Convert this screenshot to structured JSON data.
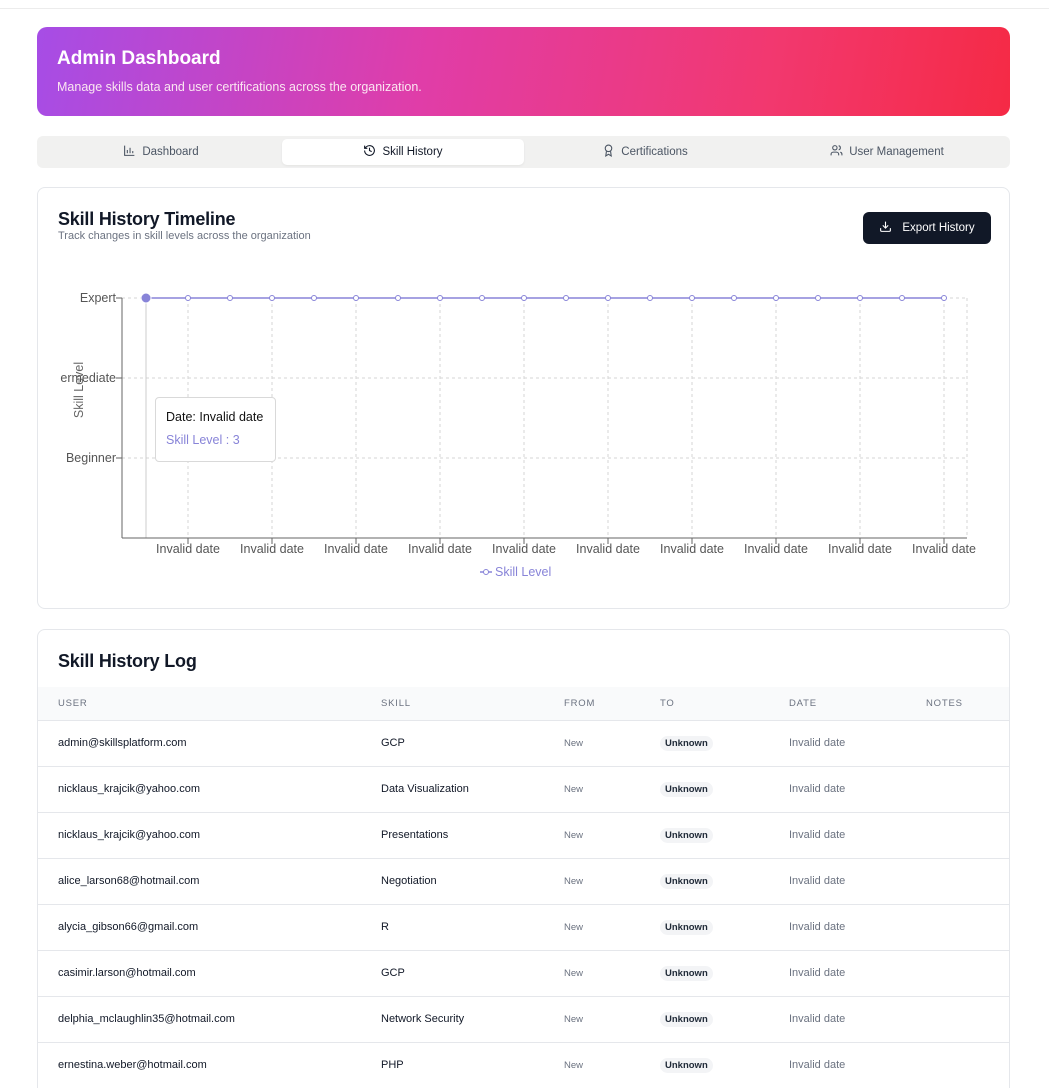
{
  "header": {
    "title": "Admin Dashboard",
    "subtitle": "Manage skills data and user certifications across the organization."
  },
  "tabs": [
    {
      "label": "Dashboard",
      "icon": "bar-chart-icon",
      "active": false
    },
    {
      "label": "Skill History",
      "icon": "history-icon",
      "active": true
    },
    {
      "label": "Certifications",
      "icon": "award-icon",
      "active": false
    },
    {
      "label": "User Management",
      "icon": "users-icon",
      "active": false
    }
  ],
  "timeline": {
    "title": "Skill History Timeline",
    "subtitle": "Track changes in skill levels across the organization",
    "export_label": "Export History",
    "export_icon": "download-icon",
    "tooltip": {
      "date_line": "Date: Invalid date",
      "value_line": "Skill Level : 3"
    }
  },
  "chart_data": {
    "type": "line",
    "ylabel": "Skill Level",
    "y_ticks": [
      {
        "value": 1,
        "label": "Beginner"
      },
      {
        "value": 2,
        "label": "ermediate"
      },
      {
        "value": 3,
        "label": "Expert"
      }
    ],
    "ylim": [
      0,
      3
    ],
    "x_tick_labels": [
      "Invalid date",
      "Invalid date",
      "Invalid date",
      "Invalid date",
      "Invalid date",
      "Invalid date",
      "Invalid date",
      "Invalid date",
      "Invalid date",
      "Invalid date"
    ],
    "series": [
      {
        "name": "Skill Level",
        "color": "#8884d8",
        "values": [
          3,
          3,
          3,
          3,
          3,
          3,
          3,
          3,
          3,
          3,
          3,
          3,
          3,
          3,
          3,
          3,
          3,
          3,
          3,
          3
        ]
      }
    ],
    "active_index": 0,
    "grid": true,
    "legend": "bottom"
  },
  "log": {
    "title": "Skill History Log",
    "columns": [
      "USER",
      "SKILL",
      "FROM",
      "TO",
      "DATE",
      "NOTES"
    ],
    "rows": [
      {
        "user": "admin@skillsplatform.com",
        "skill": "GCP",
        "from": "New",
        "to": "Unknown",
        "date": "Invalid date",
        "notes": ""
      },
      {
        "user": "nicklaus_krajcik@yahoo.com",
        "skill": "Data Visualization",
        "from": "New",
        "to": "Unknown",
        "date": "Invalid date",
        "notes": ""
      },
      {
        "user": "nicklaus_krajcik@yahoo.com",
        "skill": "Presentations",
        "from": "New",
        "to": "Unknown",
        "date": "Invalid date",
        "notes": ""
      },
      {
        "user": "alice_larson68@hotmail.com",
        "skill": "Negotiation",
        "from": "New",
        "to": "Unknown",
        "date": "Invalid date",
        "notes": ""
      },
      {
        "user": "alycia_gibson66@gmail.com",
        "skill": "R",
        "from": "New",
        "to": "Unknown",
        "date": "Invalid date",
        "notes": ""
      },
      {
        "user": "casimir.larson@hotmail.com",
        "skill": "GCP",
        "from": "New",
        "to": "Unknown",
        "date": "Invalid date",
        "notes": ""
      },
      {
        "user": "delphia_mclaughlin35@hotmail.com",
        "skill": "Network Security",
        "from": "New",
        "to": "Unknown",
        "date": "Invalid date",
        "notes": ""
      },
      {
        "user": "ernestina.weber@hotmail.com",
        "skill": "PHP",
        "from": "New",
        "to": "Unknown",
        "date": "Invalid date",
        "notes": ""
      }
    ]
  }
}
